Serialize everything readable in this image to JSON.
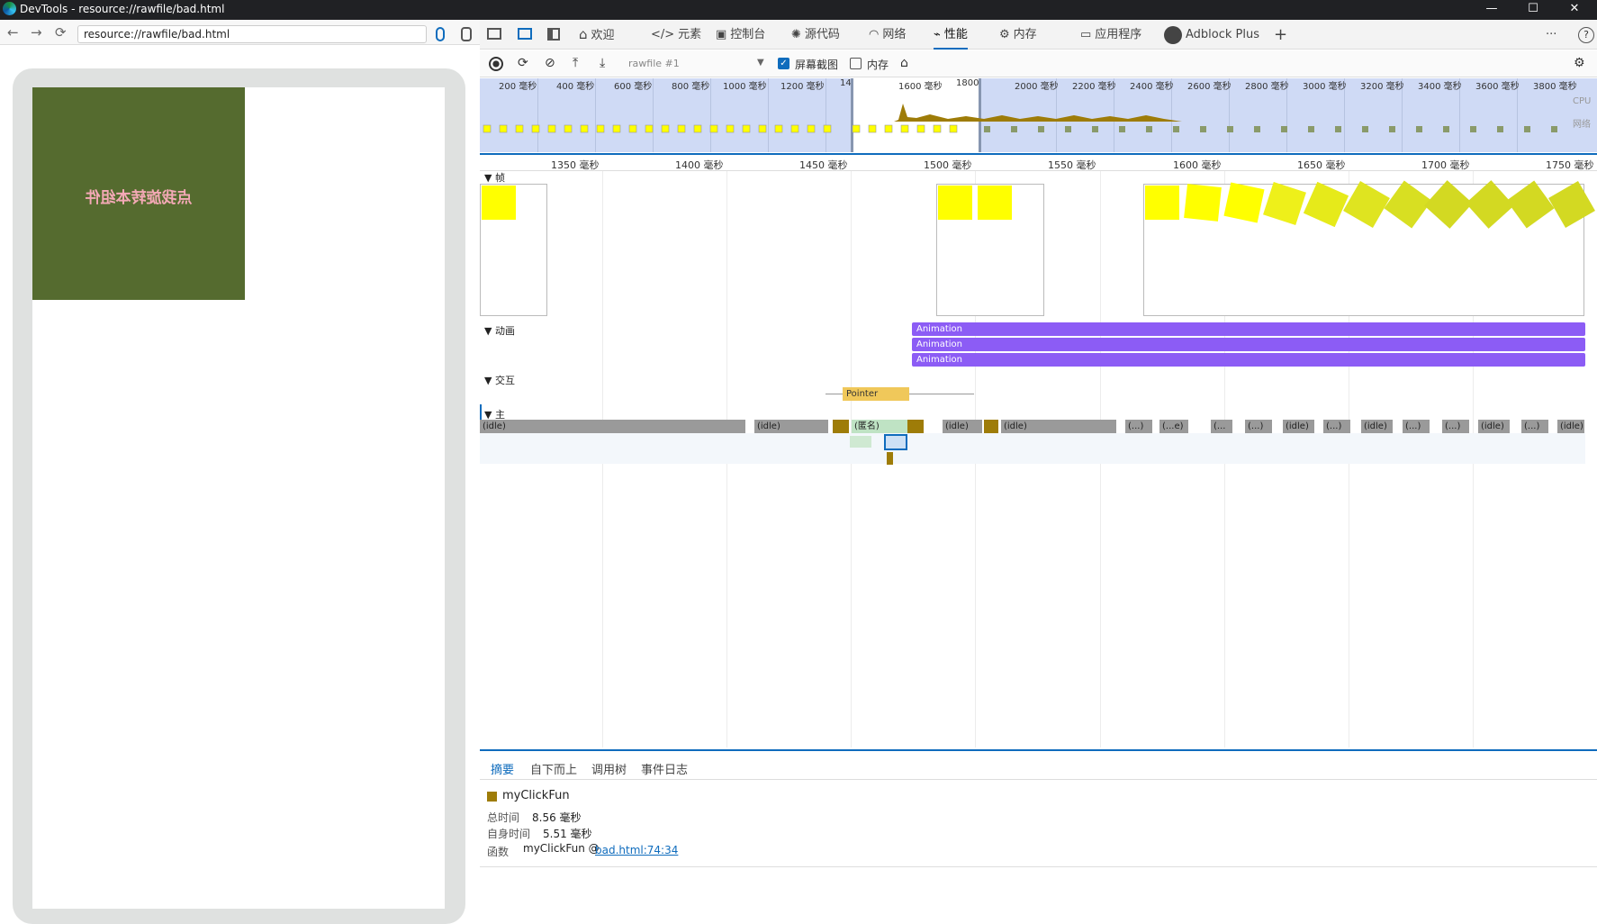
{
  "window": {
    "title": "DevTools - resource://rawfile/bad.html",
    "min": "—",
    "max": "☐",
    "close": "✕"
  },
  "address": {
    "url": "resource://rawfile/bad.html",
    "back": "←",
    "forward": "→",
    "reload": "⟳"
  },
  "page": {
    "text": "点我旋转本组件"
  },
  "devtools_tabs": [
    {
      "label": "欢迎",
      "icon": "home-icon"
    },
    {
      "label": "元素",
      "icon": "code-icon"
    },
    {
      "label": "控制台",
      "icon": "console-icon"
    },
    {
      "label": "源代码",
      "icon": "bug-icon"
    },
    {
      "label": "网络",
      "icon": "wifi-icon"
    },
    {
      "label": "性能",
      "icon": "performance-icon"
    },
    {
      "label": "内存",
      "icon": "memory-icon"
    },
    {
      "label": "应用程序",
      "icon": "app-icon"
    },
    {
      "label": "Adblock Plus",
      "icon": "adblock-icon"
    }
  ],
  "toolbar": {
    "profile": "rawfile #1",
    "screenshots_label": "屏幕截图",
    "screenshots_checked": true,
    "memory_label": "内存",
    "memory_checked": false,
    "more": "···",
    "help": "?",
    "add": "+"
  },
  "overview": {
    "ticks": [
      "200 毫秒",
      "400 毫秒",
      "600 毫秒",
      "800 毫秒",
      "1000 毫秒",
      "1200 毫秒",
      "14",
      "1600 毫秒",
      "1800",
      "2000 毫秒",
      "2200 毫秒",
      "2400 毫秒",
      "2600 毫秒",
      "2800 毫秒",
      "3000 毫秒",
      "3200 毫秒",
      "3400 毫秒",
      "3600 毫秒",
      "3800 毫秒"
    ],
    "cpu": "CPU",
    "net": "网络"
  },
  "ruler": {
    "ticks": [
      "1350 毫秒",
      "1400 毫秒",
      "1450 毫秒",
      "1500 毫秒",
      "1550 毫秒",
      "1600 毫秒",
      "1650 毫秒",
      "1700 毫秒",
      "1750 毫秒"
    ]
  },
  "tracks": {
    "frames": "▼ 帧",
    "animations": "▼ 动画",
    "interactions": "▼ 交互",
    "main": "▼ 主"
  },
  "animations": [
    "Animation",
    "Animation",
    "Animation"
  ],
  "interaction": {
    "label": "Pointer"
  },
  "main_blocks": [
    "(idle)",
    "(idle)",
    "(匿名)",
    "(idle)",
    "(idle)",
    "(...)",
    "(...e)",
    "(...",
    "(...)",
    "(idle)",
    "(...)",
    "(idle)",
    "(...)",
    "(...)",
    "(idle)",
    "(...)",
    "(idle)"
  ],
  "bottom_tabs": [
    "摘要",
    "自下而上",
    "调用树",
    "事件日志"
  ],
  "summary": {
    "name": "myClickFun",
    "total_label": "总时间",
    "total_value": "8.56 毫秒",
    "self_label": "自身时间",
    "self_value": "5.51 毫秒",
    "func_label": "函数",
    "func_value": "myClickFun @",
    "func_link": "bad.html:74:34"
  },
  "colors": {
    "accent": "#0f6cbd",
    "idle": "#9a9a9a",
    "task": "#9e7c08",
    "animation": "#8c5cf5",
    "pointer": "#f0c85a",
    "screenshot": "#ffff00",
    "device_green": "#556b2f"
  }
}
